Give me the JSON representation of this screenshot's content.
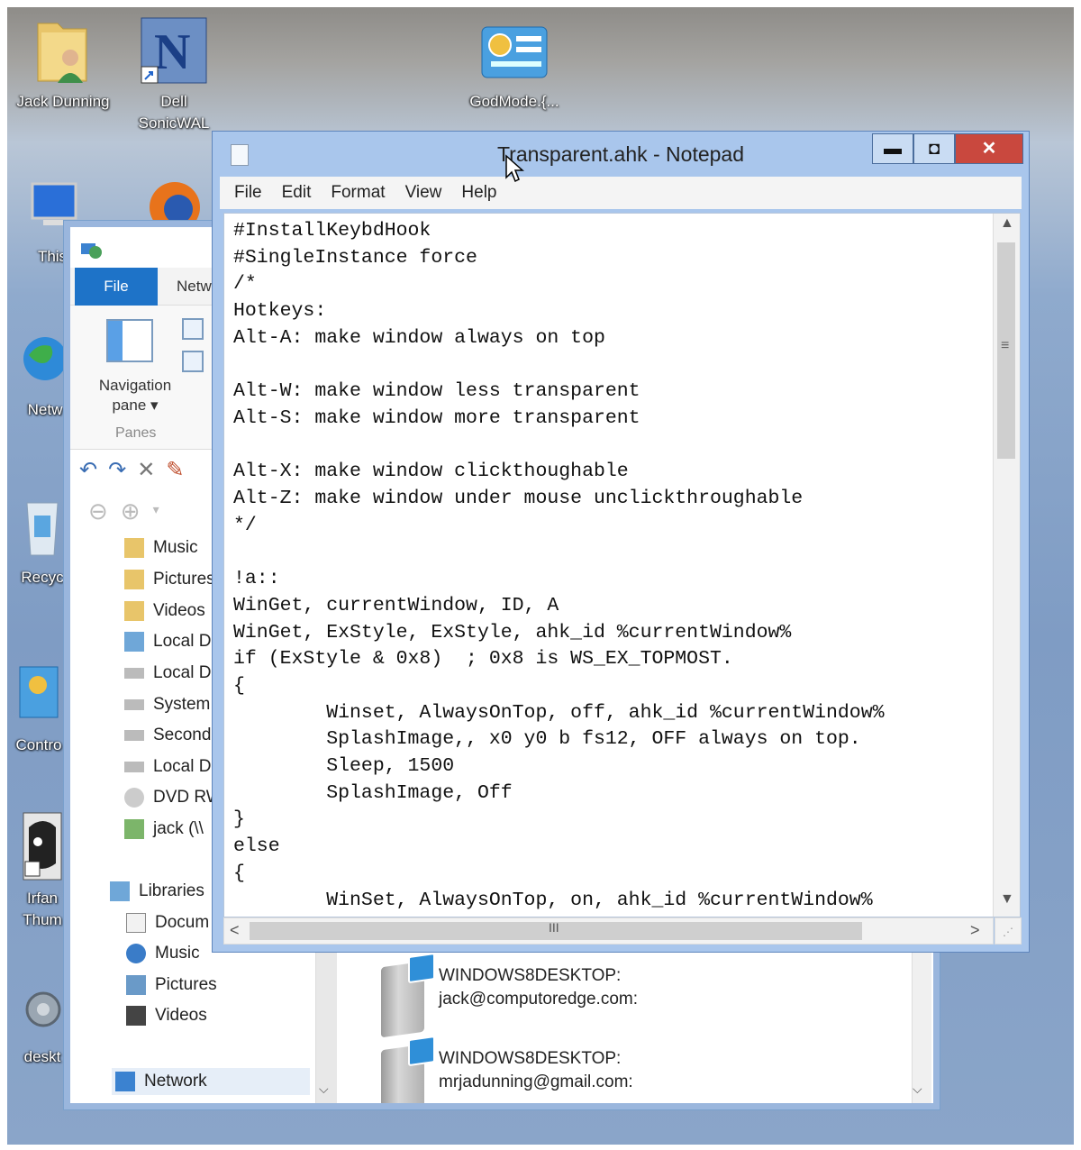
{
  "desktop": {
    "icons": [
      {
        "label": "Jack Dunning"
      },
      {
        "label": "Dell",
        "label2": "SonicWAL"
      },
      {
        "label": "GodMode.{..."
      },
      {
        "label": "This"
      },
      {
        "label": "Netw"
      },
      {
        "label": "Recyc"
      },
      {
        "label": "Contro"
      },
      {
        "label": "Irfan",
        "label2": "Thum"
      },
      {
        "label": "deskt"
      }
    ]
  },
  "explorer": {
    "tabs": {
      "file": "File",
      "network": "Netw"
    },
    "ribbon": {
      "nav_pane_line1": "Navigation",
      "nav_pane_line2": "pane ▾",
      "panes": "Panes"
    },
    "qat": [
      "↶",
      "↷",
      "✕",
      "✎"
    ],
    "tree": [
      {
        "label": "Music"
      },
      {
        "label": "Pictures"
      },
      {
        "label": "Videos"
      },
      {
        "label": "Local Di"
      },
      {
        "label": "Local Di"
      },
      {
        "label": "System"
      },
      {
        "label": "Second"
      },
      {
        "label": "Local Di"
      },
      {
        "label": "DVD RW"
      },
      {
        "label": "jack (\\\\"
      },
      {
        "label": "Libraries"
      },
      {
        "label": "Docum"
      },
      {
        "label": "Music"
      },
      {
        "label": "Pictures"
      },
      {
        "label": "Videos"
      },
      {
        "label": "Network"
      }
    ],
    "network_items": [
      {
        "line1": "WINDOWS8DESKTOP:",
        "line2": "jack@computoredge.com:"
      },
      {
        "line1": "WINDOWS8DESKTOP:",
        "line2": "mrjadunning@gmail.com:"
      }
    ]
  },
  "notepad": {
    "title": "Transparent.ahk - Notepad",
    "buttons": {
      "minimize": "▬",
      "maximize": "◘",
      "close": "✕"
    },
    "menu": [
      "File",
      "Edit",
      "Format",
      "View",
      "Help"
    ],
    "content": "#InstallKeybdHook\n#SingleInstance force\n/*\nHotkeys:\nAlt-A: make window always on top\n\nAlt-W: make window less transparent\nAlt-S: make window more transparent\n\nAlt-X: make window clickthoughable\nAlt-Z: make window under mouse unclickthroughable\n*/\n\n!a::\nWinGet, currentWindow, ID, A\nWinGet, ExStyle, ExStyle, ahk_id %currentWindow%\nif (ExStyle & 0x8)  ; 0x8 is WS_EX_TOPMOST.\n{\n        Winset, AlwaysOnTop, off, ahk_id %currentWindow%\n        SplashImage,, x0 y0 b fs12, OFF always on top.\n        Sleep, 1500\n        SplashImage, Off\n}\nelse\n{\n        WinSet, AlwaysOnTop, on, ahk_id %currentWindow%",
    "scroll": {
      "up": "▲",
      "down": "▼",
      "left": "<",
      "right": ">",
      "vgrip": "≡",
      "hgrip": "III"
    }
  }
}
